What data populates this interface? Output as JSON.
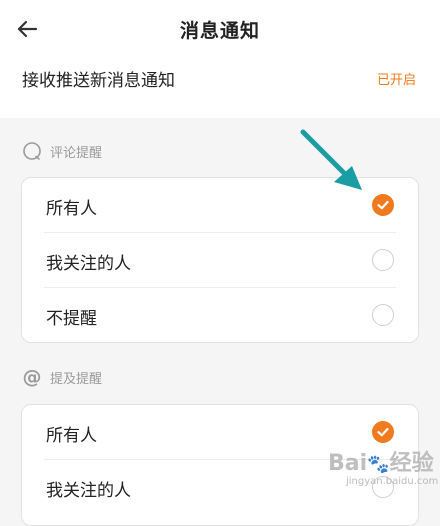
{
  "header": {
    "title": "消息通知",
    "back_icon": "arrow-left-icon"
  },
  "push": {
    "label": "接收推送新消息通知",
    "status": "已开启",
    "status_color": "#f07a1e"
  },
  "comment_section": {
    "icon": "chat-bubble-icon",
    "label": "评论提醒",
    "options": [
      {
        "label": "所有人",
        "selected": true
      },
      {
        "label": "我关注的人",
        "selected": false
      },
      {
        "label": "不提醒",
        "selected": false
      }
    ]
  },
  "mention_section": {
    "icon": "at-sign-icon",
    "label": "提及提醒",
    "options": [
      {
        "label": "所有人",
        "selected": true
      },
      {
        "label": "我关注的人",
        "selected": false
      }
    ]
  },
  "accent_color": "#f07a1e",
  "annotation_color": "#1a9ea4",
  "watermark": {
    "text": "Bai度经验",
    "sub": "jingyan.baidu.com"
  }
}
